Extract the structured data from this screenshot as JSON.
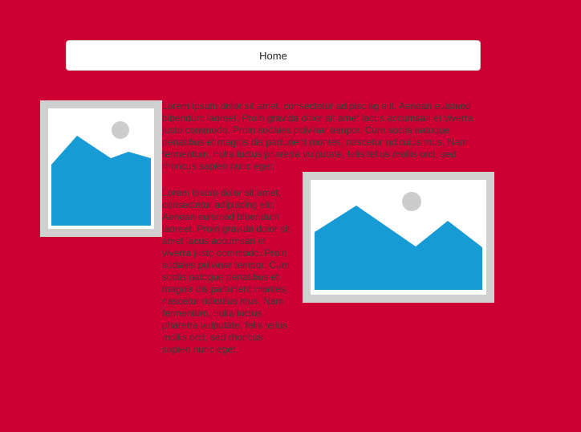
{
  "nav": {
    "home_label": "Home"
  },
  "content": {
    "paragraph_1": "Lorem ipsum dolor sit amet, consectetur adipiscing elit. Aenean euismod bibendum laoreet. Proin gravida dolor sit amet lacus accumsan et viverra justo commodo. Proin sodales pulvinar tempor. Cum sociis natoque penatibus et magnis dis parturient montes, nascetur ridiculus mus. Nam fermentum, nulla luctus pharetra vulputate, felis tellus mollis orci, sed rhoncus sapien nunc eget.",
    "paragraph_2": "Lorem ipsum dolor sit amet, consectetur adipiscing elit. Aenean euismod bibendum laoreet. Proin gravida dolor sit amet lacus accumsan et viverra justo commodo. Proin sodales pulvinar tempor. Cum sociis natoque penatibus et magnis dis parturient montes, nascetur ridiculus mus. Nam fermentum, nulla luctus pharetra vulputate, felis tellus mollis orci, sed rhoncus sapien nunc eget.",
    "images": [
      {
        "icon": "image-placeholder-icon"
      },
      {
        "icon": "image-placeholder-icon"
      }
    ]
  },
  "colors": {
    "background": "#cc0033",
    "placeholder_frame": "#d0d0d0",
    "placeholder_mountain": "#169bd5",
    "placeholder_sun": "#cccccc",
    "button_bg": "#ffffff"
  }
}
